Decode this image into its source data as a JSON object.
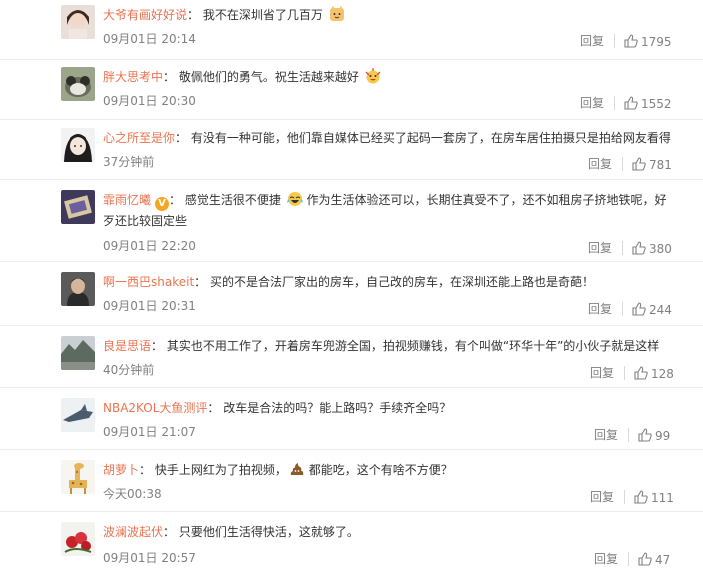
{
  "comments": [
    {
      "user": "大爷有画好好说",
      "text": "我不在深圳省了几百万",
      "time": "09月01日 20:14",
      "reply": "回复",
      "likes": "1795"
    },
    {
      "user": "胖大思考中",
      "text": "敬佩他们的勇气。祝生活越来越好",
      "time": "09月01日 20:30",
      "reply": "回复",
      "likes": "1552"
    },
    {
      "user": "心之所至是你",
      "text": "有没有一种可能，他们靠自媒体已经买了起码一套房了，在房车居住拍摄只是拍给网友看得",
      "time": "37分钟前",
      "reply": "回复",
      "likes": "781"
    },
    {
      "user": "霏雨忆曦",
      "text": "感觉生活很不便捷",
      "text2": "作为生活体验还可以，长期住真受不了，还不如租房子挤地铁呢，好歹还比较固定些",
      "time": "09月01日 22:20",
      "reply": "回复",
      "likes": "380"
    },
    {
      "user": "啊一西巴shakeit",
      "text": "买的不是合法厂家出的房车，自己改的房车，在深圳还能上路也是奇葩！",
      "time": "09月01日 20:31",
      "reply": "回复",
      "likes": "244"
    },
    {
      "user": "良是思语",
      "text": "其实也不用工作了，开着房车兜游全国，拍视频赚钱，有个叫做“环华十年”的小伙子就是这样",
      "time": "40分钟前",
      "reply": "回复",
      "likes": "128"
    },
    {
      "user": "NBA2KOL大鱼测评",
      "text": "改车是合法的吗？能上路吗？手续齐全吗？",
      "time": "09月01日 21:07",
      "reply": "回复",
      "likes": "99"
    },
    {
      "user": "胡萝卜",
      "text": "快手上网红为了拍视频，",
      "text2": "都能吃，这个有啥不方便？",
      "time": "今天00:38",
      "reply": "回复",
      "likes": "111"
    },
    {
      "user": "波澜波起伏",
      "text": "只要他们生活得快活，这就够了。",
      "time": "09月01日 20:57",
      "reply": "回复",
      "likes": "47"
    }
  ],
  "separator": "：",
  "badge_label": "V",
  "colors": {
    "username": "#eb7350",
    "meta": "#808080",
    "text": "#333333",
    "divider": "#ececec"
  }
}
